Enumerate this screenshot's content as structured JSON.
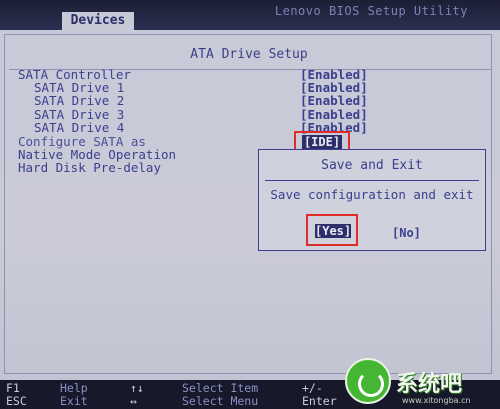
{
  "topbar": {
    "tab": "Devices",
    "app_title": "Lenovo BIOS Setup Utility"
  },
  "section_title": "ATA Drive Setup",
  "settings": [
    {
      "label": "SATA Controller",
      "value": "[Enabled]"
    },
    {
      "label": "SATA Drive 1",
      "value": "[Enabled]"
    },
    {
      "label": "SATA Drive 2",
      "value": "[Enabled]"
    },
    {
      "label": "SATA Drive 3",
      "value": "[Enabled]"
    },
    {
      "label": "SATA Drive 4",
      "value": "[Enabled]"
    },
    {
      "label": "Configure SATA as",
      "value": "[IDE]"
    },
    {
      "label": "Native Mode Operation",
      "value": ""
    },
    {
      "label": "Hard Disk Pre-delay",
      "value": ""
    }
  ],
  "dialog": {
    "title": "Save and Exit",
    "message": "Save configuration and exit",
    "yes": "[Yes]",
    "no": "[No]"
  },
  "footer": {
    "f1_key": "F1",
    "f1_desc": "Help",
    "esc_key": "ESC",
    "esc_desc": "Exit",
    "updown_key": "↑↓",
    "updown_desc": "Select Item",
    "leftright_key": "↔",
    "leftright_desc": "Select Menu",
    "plusminus_key": "+/-",
    "enter_key": "Enter"
  },
  "watermark": {
    "brand": "系统吧",
    "url": "www.xitongba.cn"
  },
  "colors": {
    "panel_bg": "#c8cad8",
    "text": "#3b3f8e",
    "highlight": "#e12b2b",
    "selected_bg": "#2d2f6a"
  }
}
